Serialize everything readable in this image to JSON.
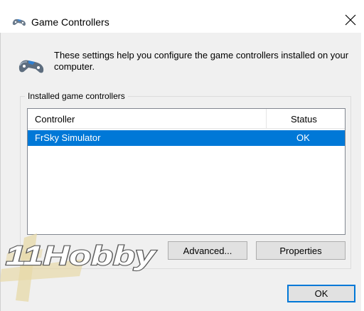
{
  "window": {
    "title": "Game Controllers",
    "close_glyph": "✕"
  },
  "info": {
    "text": "These settings help you configure the game controllers installed on your computer.",
    "icon": "gamepad-icon"
  },
  "group": {
    "label": "Installed game controllers"
  },
  "list": {
    "columns": [
      "Controller",
      "Status"
    ],
    "rows": [
      {
        "name": "FrSky Simulator",
        "status": "OK",
        "selected": true
      }
    ]
  },
  "buttons": {
    "advanced": "Advanced...",
    "properties": "Properties",
    "ok": "OK"
  },
  "watermark": {
    "text": "11Hobby"
  },
  "colors": {
    "selection": "#0078d7",
    "dialog_bg": "#f0f0f0",
    "watermark_fill": "#d8c178"
  }
}
